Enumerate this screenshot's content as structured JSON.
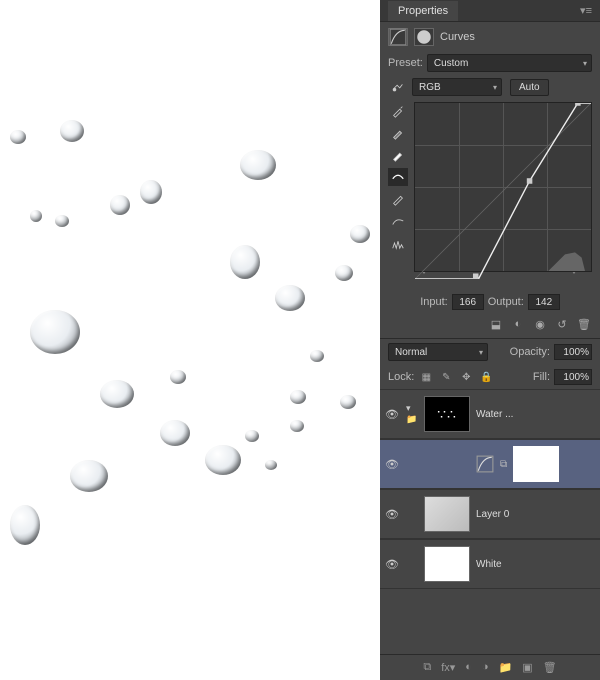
{
  "panel": {
    "title": "Properties"
  },
  "curves": {
    "name": "Curves",
    "preset_label": "Preset:",
    "preset_value": "Custom",
    "channel": "RGB",
    "auto_label": "Auto",
    "input_label": "Input:",
    "input_value": "166",
    "output_label": "Output:",
    "output_value": "142"
  },
  "layers": {
    "blend_mode": "Normal",
    "opacity_label": "Opacity:",
    "opacity_value": "100%",
    "lock_label": "Lock:",
    "fill_label": "Fill:",
    "fill_value": "100%",
    "items": [
      {
        "name": "Water ..."
      },
      {
        "name": ""
      },
      {
        "name": "Layer 0"
      },
      {
        "name": "White"
      }
    ]
  },
  "chart_data": {
    "type": "line",
    "title": "Curves adjustment",
    "xlabel": "Input",
    "ylabel": "Output",
    "xlim": [
      0,
      255
    ],
    "ylim": [
      0,
      255
    ],
    "series": [
      {
        "name": "RGB",
        "x": [
          0,
          92,
          166,
          236,
          255
        ],
        "y": [
          0,
          0,
          142,
          255,
          255
        ]
      }
    ],
    "histogram_peak_range": [
      210,
      255
    ]
  }
}
